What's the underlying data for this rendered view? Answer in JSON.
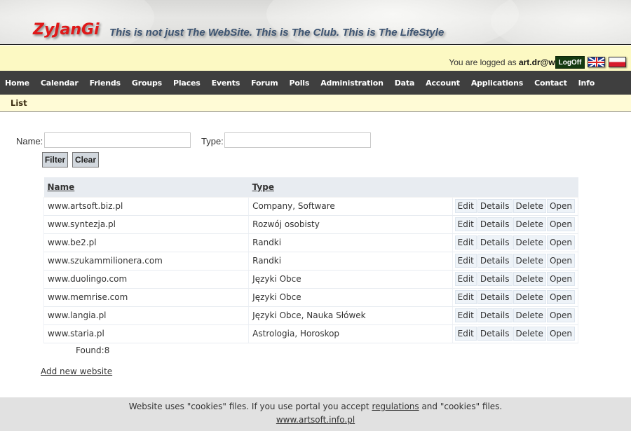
{
  "header": {
    "logo": "ZyJanGi",
    "slogan": "This is not just The WebSite. This is The Club. This is The LifeStyle"
  },
  "userbar": {
    "logged_prefix": "You are logged as ",
    "user_email": "art.dr@wp.pl",
    "logoff_label": "LogOff",
    "flags": [
      {
        "name": "uk-flag-icon",
        "lang": "English"
      },
      {
        "name": "pl-flag-icon",
        "lang": "Polish"
      }
    ]
  },
  "nav": {
    "items": [
      "Home",
      "Calendar",
      "Friends",
      "Groups",
      "Places",
      "Events",
      "Forum",
      "Polls",
      "Administration",
      "Data",
      "Account",
      "Applications",
      "Contact",
      "Info"
    ]
  },
  "subnav": {
    "items": [
      "List"
    ]
  },
  "filter": {
    "name_label": "Name:",
    "name_value": "",
    "type_label": "Type:",
    "type_value": "",
    "filter_button": "Filter",
    "clear_button": "Clear"
  },
  "table": {
    "columns": [
      "Name",
      "Type"
    ],
    "actions": [
      "Edit",
      "Details",
      "Delete",
      "Open"
    ],
    "rows": [
      {
        "name": "www.artsoft.biz.pl",
        "type": "Company, Software"
      },
      {
        "name": "www.syntezja.pl",
        "type": "Rozwój osobisty"
      },
      {
        "name": "www.be2.pl",
        "type": "Randki"
      },
      {
        "name": "www.szukammilionera.com",
        "type": "Randki"
      },
      {
        "name": "www.duolingo.com",
        "type": "Języki Obce"
      },
      {
        "name": "www.memrise.com",
        "type": "Języki Obce"
      },
      {
        "name": "www.langia.pl",
        "type": "Języki Obce, Nauka Słówek"
      },
      {
        "name": "www.staria.pl",
        "type": "Astrologia, Horoskop"
      }
    ],
    "found_label": "Found:8"
  },
  "add_link": "Add new website",
  "footer": {
    "cookie_text_before": "Website uses \"cookies\" files. If you use portal you accept ",
    "regulations_link": "regulations",
    "cookie_text_after": " and \"cookies\" files.",
    "site_link": "www.artsoft.info.pl"
  },
  "colors": {
    "logo": "#e01818",
    "slogan": "#3e5572",
    "navbar": "#3f3f3f",
    "userbar": "#fcf9c3",
    "subbar": "#fffbd6",
    "logoff": "#143a10",
    "table_header": "#e8ecf1",
    "footer": "#e1e1e1"
  }
}
